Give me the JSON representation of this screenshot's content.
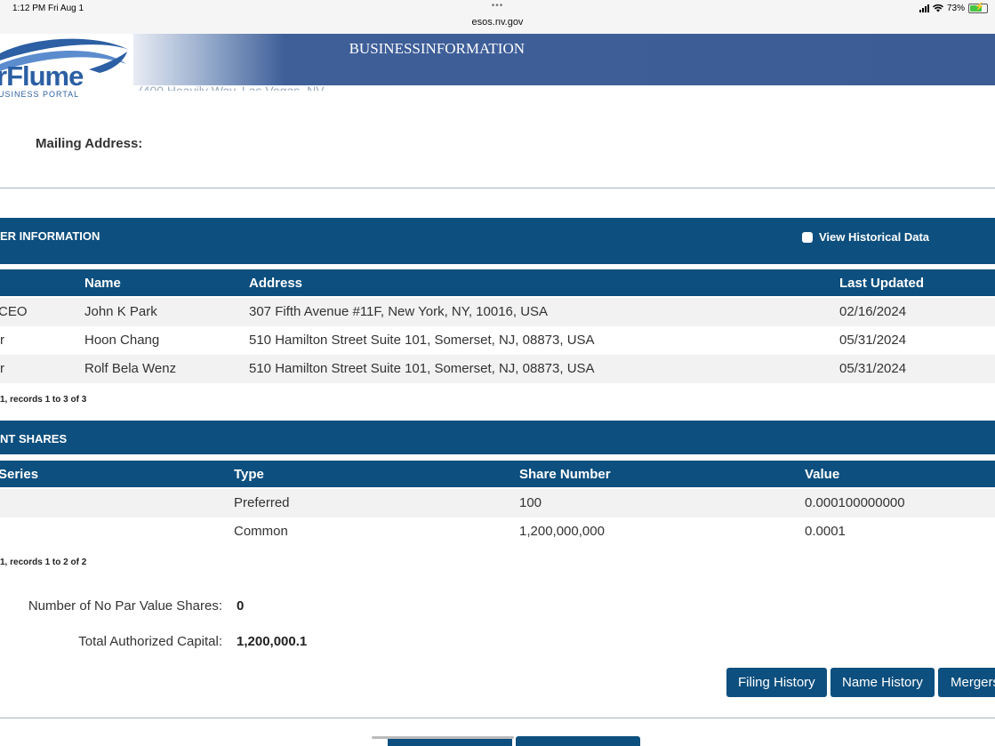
{
  "status_bar": {
    "time": "1:12 PM   Fri Aug 1",
    "dots": "•••",
    "url": "esos.nv.gov",
    "battery": "73%"
  },
  "header": {
    "logo_text": "rFlume",
    "logo_sub": "USINESS PORTAL",
    "banner_title": "BUSINESSINFORMATION",
    "ghost_text": "(400 Heavily Way, Las Vegas, NV"
  },
  "mailing": {
    "label": "Mailing Address:"
  },
  "officers": {
    "section_title": "ER INFORMATION",
    "historical_label": "View Historical Data",
    "columns": [
      "Name",
      "Address",
      "Last Updated"
    ],
    "rows": [
      {
        "title": "CEO",
        "name": "John K Park",
        "address": "307 Fifth Avenue #11F, New York, NY, 10016, USA",
        "updated": "02/16/2024"
      },
      {
        "title": "r",
        "name": "Hoon Chang",
        "address": "510 Hamilton Street Suite 101, Somerset, NJ, 08873, USA",
        "updated": "05/31/2024"
      },
      {
        "title": "r",
        "name": "Rolf Bela Wenz",
        "address": "510 Hamilton Street Suite 101, Somerset, NJ, 08873, USA",
        "updated": "05/31/2024"
      }
    ],
    "pager": "1, records 1 to 3 of 3"
  },
  "shares": {
    "section_title": "NT SHARES",
    "columns": [
      "Series",
      "Type",
      "Share Number",
      "Value"
    ],
    "rows": [
      {
        "series": "",
        "type": "Preferred",
        "number": "100",
        "value": "0.000100000000"
      },
      {
        "series": "",
        "type": "Common",
        "number": "1,200,000,000",
        "value": "0.0001"
      }
    ],
    "pager": "1, records 1 to 2 of 2"
  },
  "summary": {
    "no_par_label": "Number of No Par Value Shares:",
    "no_par_value": "0",
    "capital_label": "Total Authorized Capital:",
    "capital_value": "1,200,000.1"
  },
  "buttons": {
    "filing_history": "Filing History",
    "name_history": "Name History",
    "mergers": "Mergers"
  }
}
